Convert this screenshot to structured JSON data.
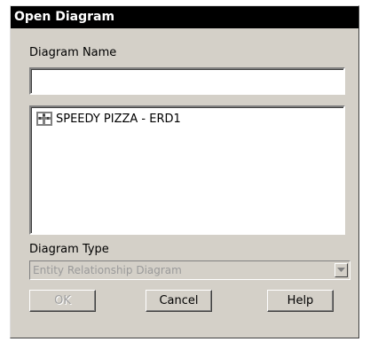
{
  "dialog": {
    "title": "Open Diagram",
    "name_label": "Diagram Name",
    "name_value": "",
    "diagrams": [
      {
        "label": "SPEEDY PIZZA - ERD1",
        "icon": "erd-diagram-icon"
      }
    ],
    "type_label": "Diagram Type",
    "type_value": "Entity Relationship Diagram",
    "buttons": {
      "ok": "OK",
      "cancel": "Cancel",
      "help": "Help"
    }
  }
}
